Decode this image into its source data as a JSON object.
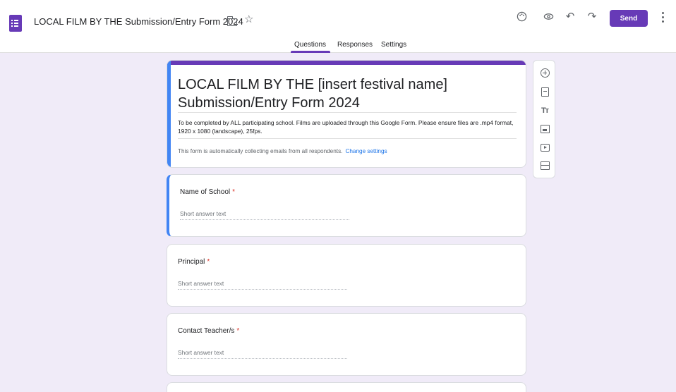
{
  "header": {
    "doc_title": "LOCAL FILM BY THE Submission/Entry Form 2024",
    "star_glyph": "☆",
    "palette_glyph": "🎨",
    "preview_glyph": "◎",
    "undo_glyph": "↶",
    "redo_glyph": "↷",
    "send_label": "Send"
  },
  "tabs": [
    {
      "label": "Questions",
      "active": true
    },
    {
      "label": "Responses",
      "active": false
    },
    {
      "label": "Settings",
      "active": false
    }
  ],
  "form": {
    "title_line1": "LOCAL FILM BY THE [insert festival name]",
    "title_line2": "Submission/Entry Form 2024",
    "description": "To be completed by ALL participating school. Films are uploaded through this Google Form. Please ensure files are .mp4 format, 1920 x 1080 (landscape), 25fps.",
    "email_note": "This form is automatically collecting emails from all respondents.",
    "change_settings": "Change settings"
  },
  "questions": [
    {
      "label": "Name of School",
      "required": "*",
      "placeholder": "Short answer text"
    },
    {
      "label": "Principal",
      "required": "*",
      "placeholder": "Short answer text"
    },
    {
      "label": "Contact Teacher/s",
      "required": "*",
      "placeholder": "Short answer text"
    }
  ],
  "toolbar": {
    "items": [
      "add-question",
      "import-questions",
      "add-title",
      "add-image",
      "add-video",
      "add-section"
    ],
    "text_glyph": "Tт"
  },
  "colors": {
    "accent": "#673ab7",
    "active_border": "#4285f4",
    "background": "#f0ebf8",
    "link": "#1a73e8",
    "required": "#d93025"
  }
}
